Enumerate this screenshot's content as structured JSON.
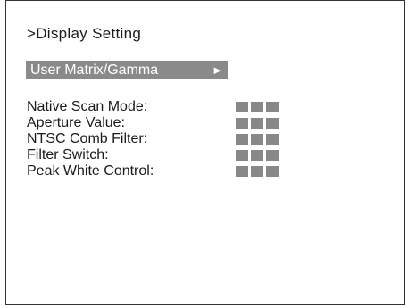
{
  "screen": {
    "title": ">Display Setting",
    "selected_item": {
      "label": "User Matrix/Gamma",
      "arrow": "►"
    },
    "settings": [
      {
        "label": "Native Scan Mode:",
        "value": "■■■"
      },
      {
        "label": "Aperture Value:",
        "value": "■■■"
      },
      {
        "label": "NTSC Comb Filter:",
        "value": "■■■"
      },
      {
        "label": "Filter Switch:",
        "value": "■■■"
      },
      {
        "label": "Peak White Control:",
        "value": "■■■"
      }
    ]
  },
  "colors": {
    "highlight_bg": "#8a8a8a",
    "value_block": "#888888",
    "border": "#333333"
  }
}
